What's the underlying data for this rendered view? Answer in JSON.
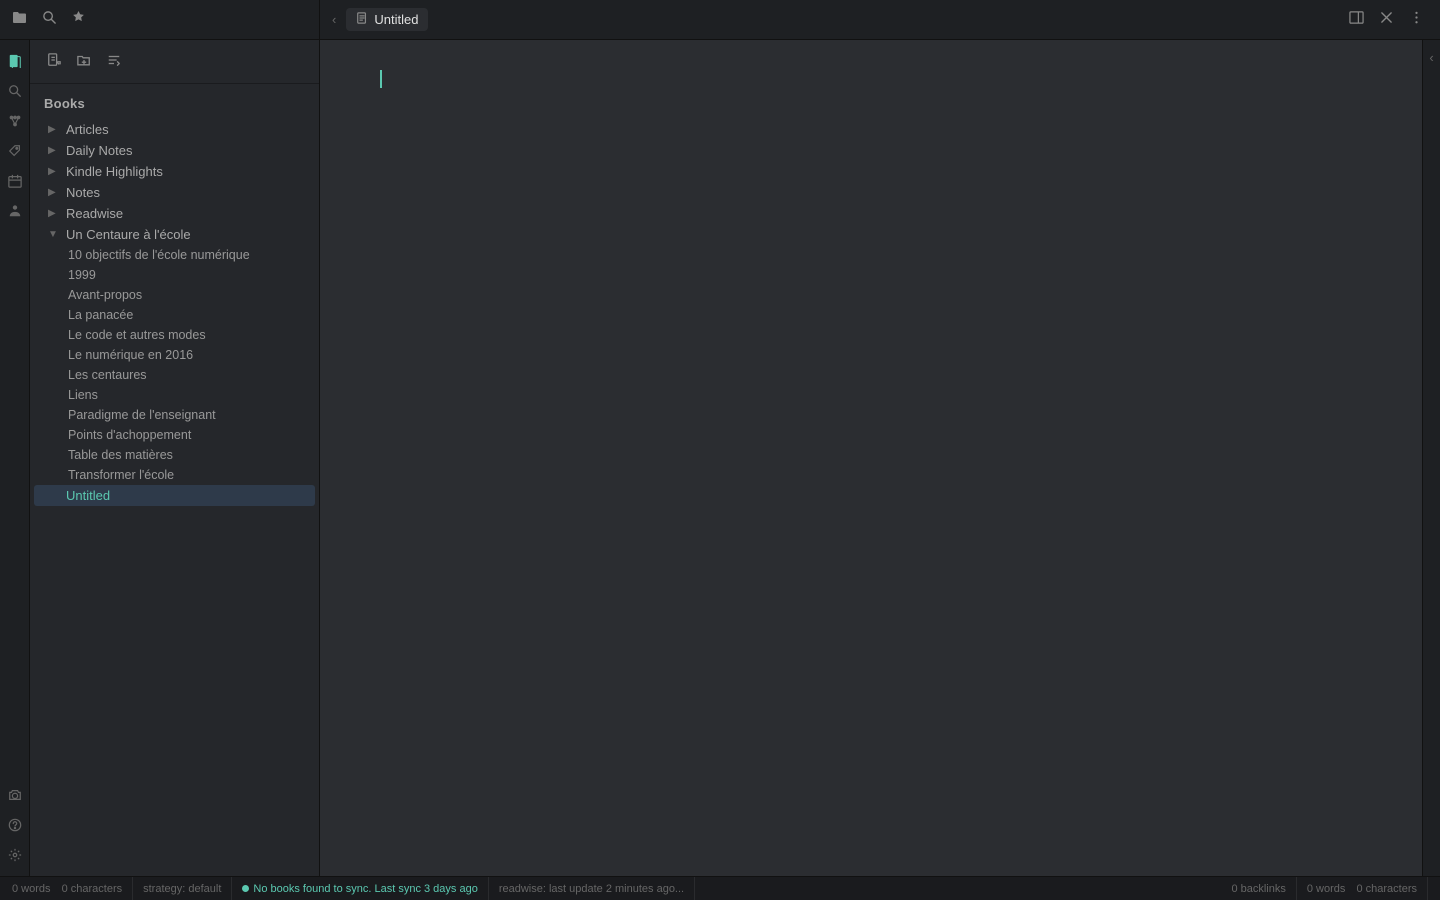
{
  "topbar": {
    "folder_icon": "🗀",
    "search_icon": "🔍",
    "star_icon": "★",
    "tab_icon": "📄",
    "tab_title": "Untitled",
    "panel_icon": "⊞",
    "close_icon": "✕",
    "more_icon": "⋮"
  },
  "sidebar": {
    "new_file_icon": "📄",
    "new_folder_icon": "📁",
    "sort_icon": "↕",
    "section_label": "Books",
    "items": [
      {
        "label": "Articles",
        "expanded": false,
        "children": []
      },
      {
        "label": "Daily Notes",
        "expanded": false,
        "children": []
      },
      {
        "label": "Kindle Highlights",
        "expanded": false,
        "children": []
      },
      {
        "label": "Notes",
        "expanded": false,
        "children": []
      },
      {
        "label": "Readwise",
        "expanded": false,
        "children": []
      },
      {
        "label": "Un Centaure à l'école",
        "expanded": true,
        "children": [
          "10 objectifs de l'école numérique",
          "1999",
          "Avant-propos",
          "La panacée",
          "Le code et autres modes",
          "Le numérique en 2016",
          "Les centaures",
          "Liens",
          "Paradigme de l'enseignant",
          "Points d'achoppement",
          "Table des matières",
          "Transformer l'école"
        ]
      },
      {
        "label": "Untitled",
        "expanded": false,
        "selected": true,
        "children": []
      }
    ]
  },
  "nav_icons": {
    "books": "⬜",
    "search2": "☰",
    "graph": "⌘",
    "tag": "⊞",
    "calendar": "📅",
    "person": "👤",
    "snapshot": "📷",
    "help": "?",
    "settings": "⚙"
  },
  "editor": {
    "placeholder": ""
  },
  "statusbar": {
    "words": "0 words",
    "characters": "0 characters",
    "strategy": "strategy: default",
    "sync_status": "No books found to sync. Last sync 3 days ago",
    "readwise": "readwise: last update 2 minutes ago...",
    "backlinks": "0 backlinks",
    "right_words": "0 words",
    "right_chars": "0 characters"
  }
}
